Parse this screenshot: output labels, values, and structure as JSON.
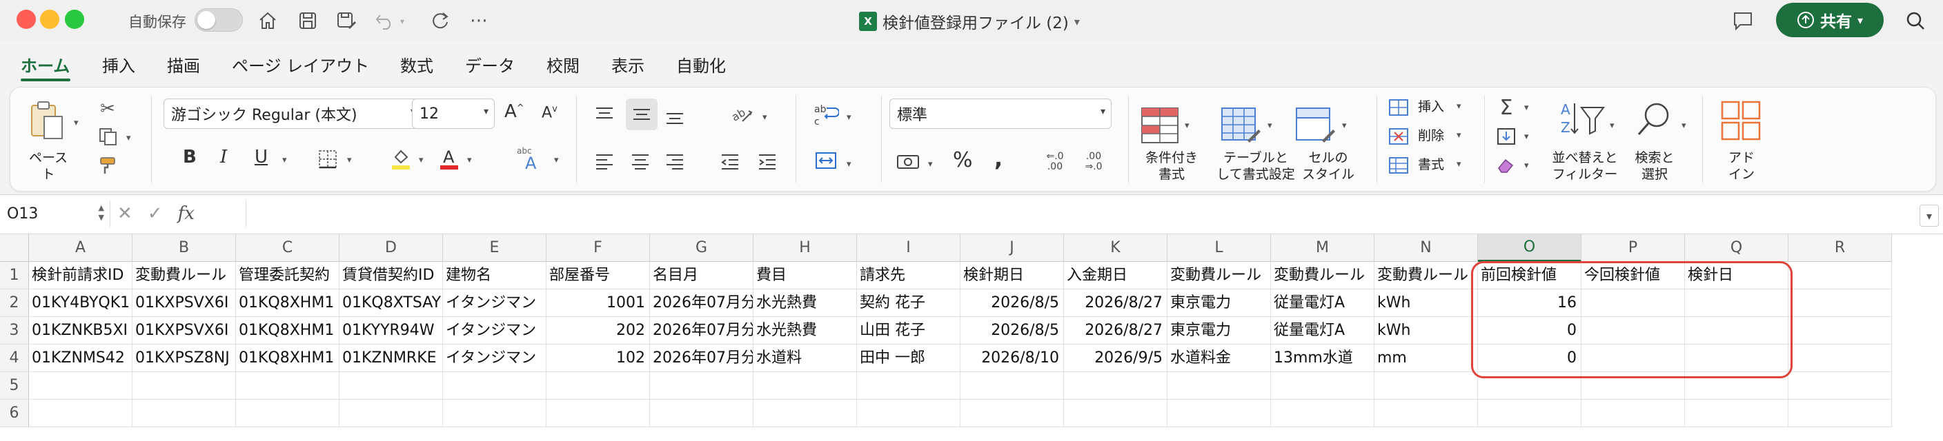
{
  "titlebar": {
    "autosave_label": "自動保存",
    "doc_title": "検針値登録用ファイル (2)",
    "share_label": "共有",
    "icons": [
      "home-icon",
      "save-icon",
      "save-as-icon",
      "undo-icon",
      "redo-icon",
      "more-icon",
      "comment-icon",
      "search-icon"
    ]
  },
  "tabs": [
    "ホーム",
    "挿入",
    "描画",
    "ページ レイアウト",
    "数式",
    "データ",
    "校閲",
    "表示",
    "自動化"
  ],
  "ribbon": {
    "paste_label": "ペースト",
    "font_name": "游ゴシック Regular (本文)",
    "font_size": "12",
    "number_format": "標準",
    "conditional_format": [
      "条件付き",
      "書式"
    ],
    "format_as_table": [
      "テーブルと",
      "して書式設定"
    ],
    "cell_styles": [
      "セルの",
      "スタイル"
    ],
    "insert_label": "挿入",
    "delete_label": "削除",
    "format_label": "書式",
    "sort_filter": [
      "並べ替えと",
      "フィルター"
    ],
    "find_select": [
      "検索と",
      "選択"
    ],
    "addins": [
      "アド",
      "イン"
    ]
  },
  "formula_bar": {
    "cell_ref": "O13",
    "fx": "fx",
    "content": ""
  },
  "grid": {
    "columns": [
      "A",
      "B",
      "C",
      "D",
      "E",
      "F",
      "G",
      "H",
      "I",
      "J",
      "K",
      "L",
      "M",
      "N",
      "O",
      "P",
      "Q",
      "R"
    ],
    "selected_column": "O",
    "rows": [
      "1",
      "2",
      "3",
      "4",
      "5",
      "6"
    ],
    "data": [
      [
        "検針前請求ID",
        "変動費ルール",
        "管理委託契約",
        "賃貸借契約ID",
        "建物名",
        "部屋番号",
        "名目月",
        "費目",
        "請求先",
        "検針期日",
        "入金期日",
        "変動費ルール",
        "変動費ルール",
        "変動費ルール",
        "前回検針値",
        "今回検針値",
        "検針日",
        ""
      ],
      [
        "01KY4BYQK1",
        "01KXPSVX6I",
        "01KQ8XHM1",
        "01KQ8XTSAY",
        "イタンジマン",
        "1001",
        "2026年07月分",
        "水光熱費",
        "契約 花子",
        "2026/8/5",
        "2026/8/27",
        "東京電力",
        "従量電灯A",
        "kWh",
        "16",
        "",
        "",
        ""
      ],
      [
        "01KZNKB5XI",
        "01KXPSVX6I",
        "01KQ8XHM1",
        "01KYYR94W",
        "イタンジマン",
        "202",
        "2026年07月分",
        "水光熱費",
        "山田 花子",
        "2026/8/5",
        "2026/8/27",
        "東京電力",
        "従量電灯A",
        "kWh",
        "0",
        "",
        "",
        ""
      ],
      [
        "01KZNMS42",
        "01KXPSZ8NJ",
        "01KQ8XHM1",
        "01KZNMRKE",
        "イタンジマン",
        "102",
        "2026年07月分",
        "水道料",
        "田中 一郎",
        "2026/8/10",
        "2026/9/5",
        "水道料金",
        "13mm水道",
        "mm",
        "0",
        "",
        "",
        ""
      ],
      [
        "",
        "",
        "",
        "",
        "",
        "",
        "",
        "",
        "",
        "",
        "",
        "",
        "",
        "",
        "",
        "",
        "",
        ""
      ],
      [
        "",
        "",
        "",
        "",
        "",
        "",
        "",
        "",
        "",
        "",
        "",
        "",
        "",
        "",
        "",
        "",
        "",
        ""
      ]
    ],
    "numeric_columns": [
      5,
      9,
      10,
      14
    ]
  },
  "colors": {
    "accent": "#1e6f3e",
    "highlight_frame": "#e0453c"
  }
}
